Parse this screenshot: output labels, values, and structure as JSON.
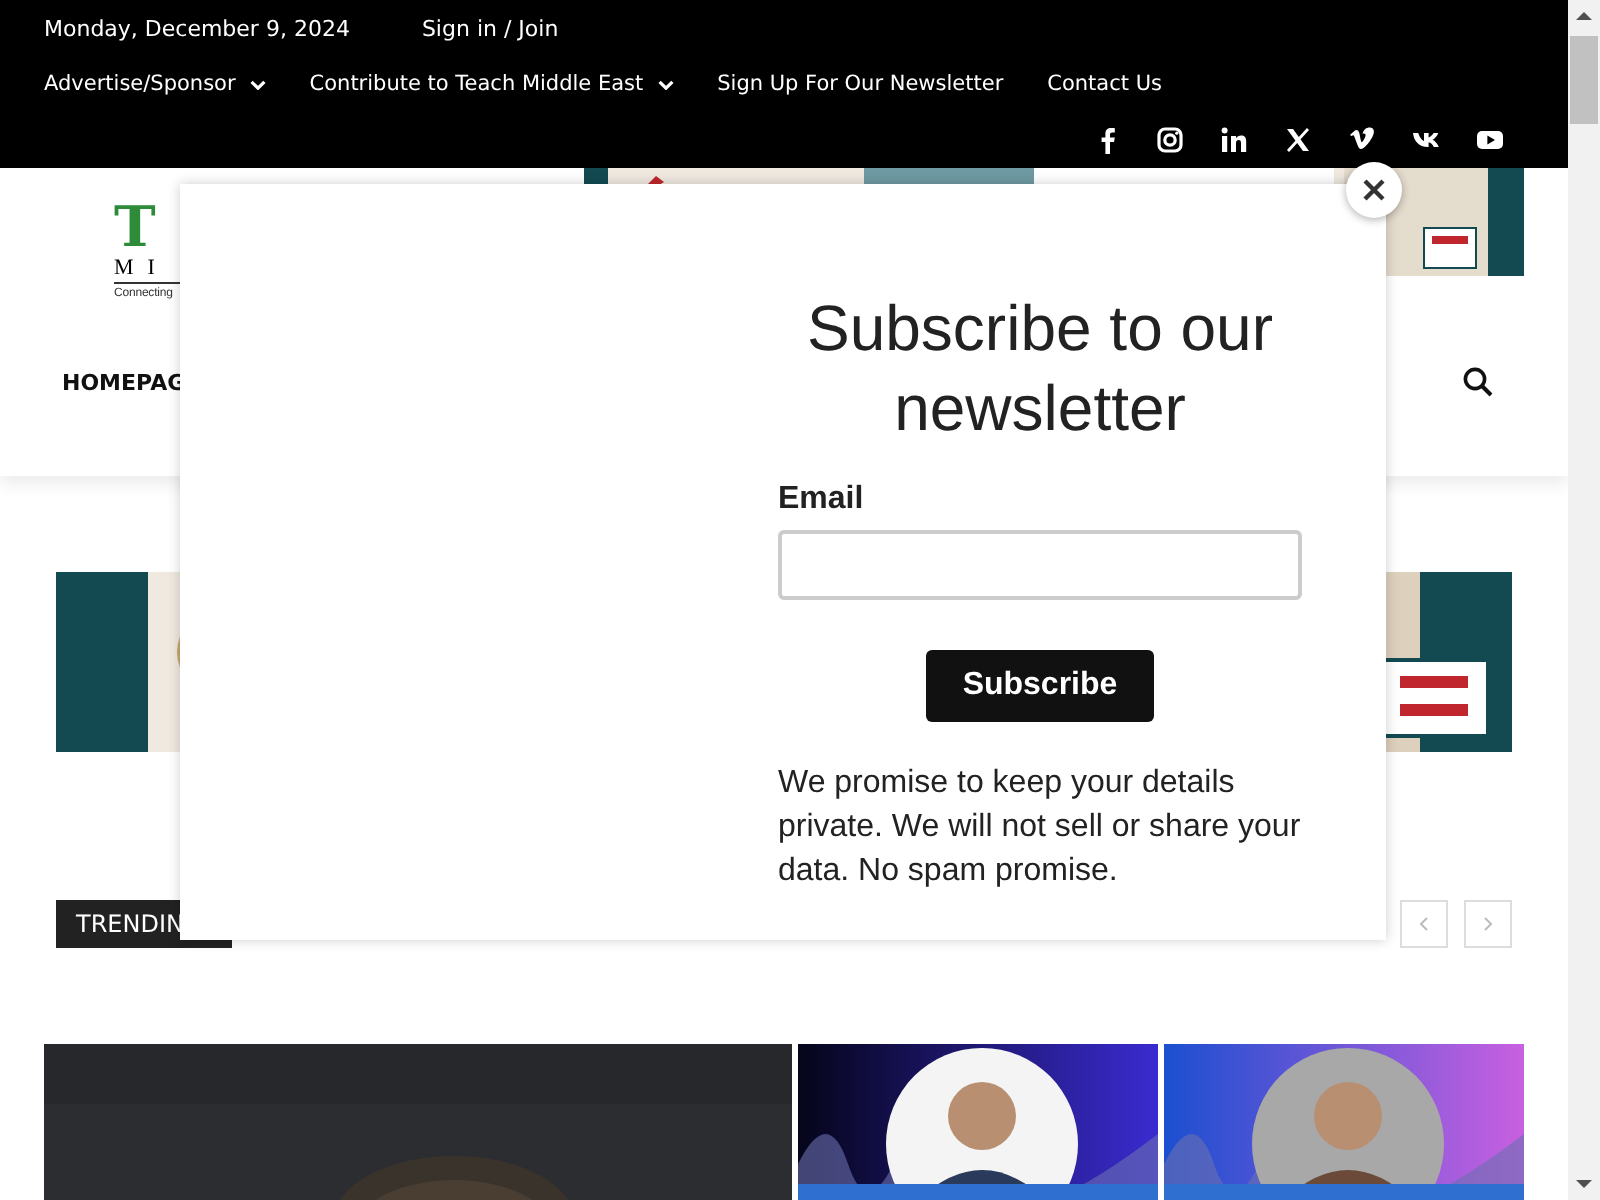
{
  "top_bar": {
    "date": "Monday, December 9, 2024",
    "sign_in": "Sign in / Join",
    "menu": [
      {
        "label": "Advertise/Sponsor",
        "dropdown": true
      },
      {
        "label": "Contribute to Teach Middle East",
        "dropdown": true
      },
      {
        "label": "Sign Up For Our Newsletter",
        "dropdown": false
      },
      {
        "label": "Contact Us",
        "dropdown": false
      }
    ]
  },
  "logo": {
    "letter": "T",
    "line": "MI",
    "tagline": "Connecting"
  },
  "nav": {
    "items": [
      "HOMEPAG"
    ]
  },
  "trending": {
    "label": "TRENDIN"
  },
  "modal": {
    "title": "Subscribe to our newsletter",
    "email_label": "Email",
    "button": "Subscribe",
    "note": "We promise to keep your details private. We will not sell or share your data. No spam promise."
  }
}
